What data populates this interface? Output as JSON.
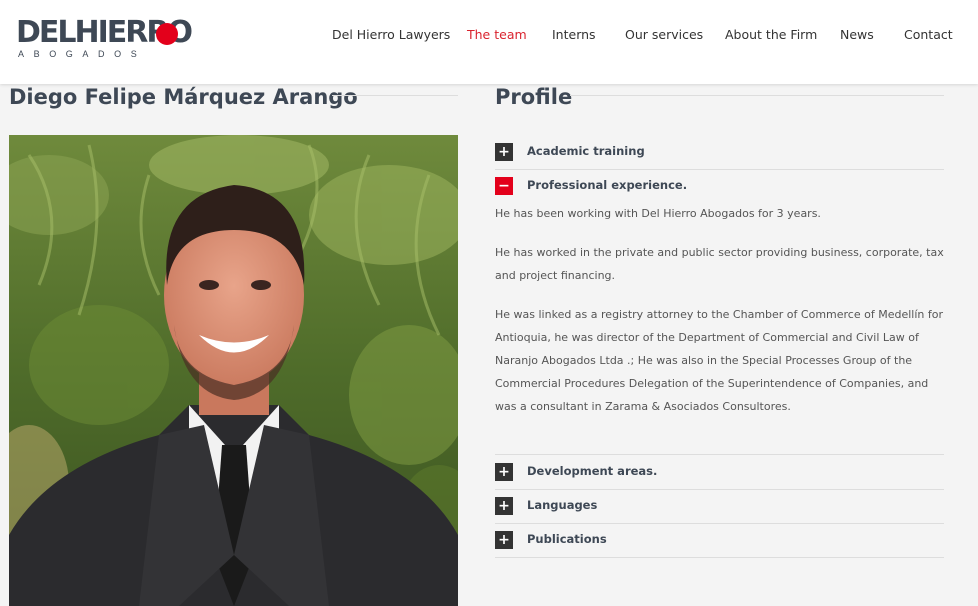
{
  "logo": {
    "main": "DELHIERRO",
    "sub": "ABOGADOS"
  },
  "nav": {
    "items": [
      {
        "label": "Del Hierro Lawyers",
        "active": false
      },
      {
        "label": "The team",
        "active": true
      },
      {
        "label": "Interns",
        "active": false
      },
      {
        "label": "Our services",
        "active": false
      },
      {
        "label": "About the Firm",
        "active": false
      },
      {
        "label": "News",
        "active": false
      },
      {
        "label": "Contact",
        "active": false
      }
    ]
  },
  "person": {
    "name": "Diego Felipe Márquez Arango"
  },
  "profile": {
    "title": "Profile",
    "sections": [
      {
        "label": "Academic training",
        "expanded": false,
        "icon": "plus-icon"
      },
      {
        "label": "Professional experience.",
        "expanded": true,
        "icon": "minus-icon"
      },
      {
        "label": "Development areas.",
        "expanded": false,
        "icon": "plus-icon"
      },
      {
        "label": "Languages",
        "expanded": false,
        "icon": "plus-icon"
      },
      {
        "label": "Publications",
        "expanded": false,
        "icon": "plus-icon"
      }
    ],
    "experience_paragraphs": [
      "He has been working with Del Hierro Abogados for 3 years.",
      "He has worked in the private and public sector providing business, corporate, tax and project financing.",
      "He was linked as a registry attorney to the Chamber of Commerce of Medellín for Antioquia, he was director of the Department of Commercial and Civil Law of Naranjo Abogados Ltda .; He was also in the Special Processes Group of the Commercial Procedures Delegation of the Superintendence of Companies, and was a consultant in Zarama & Asociados Consultores."
    ]
  },
  "colors": {
    "accent": "#e3001b",
    "nav_active": "#d9232e",
    "heading": "#3e4855"
  }
}
